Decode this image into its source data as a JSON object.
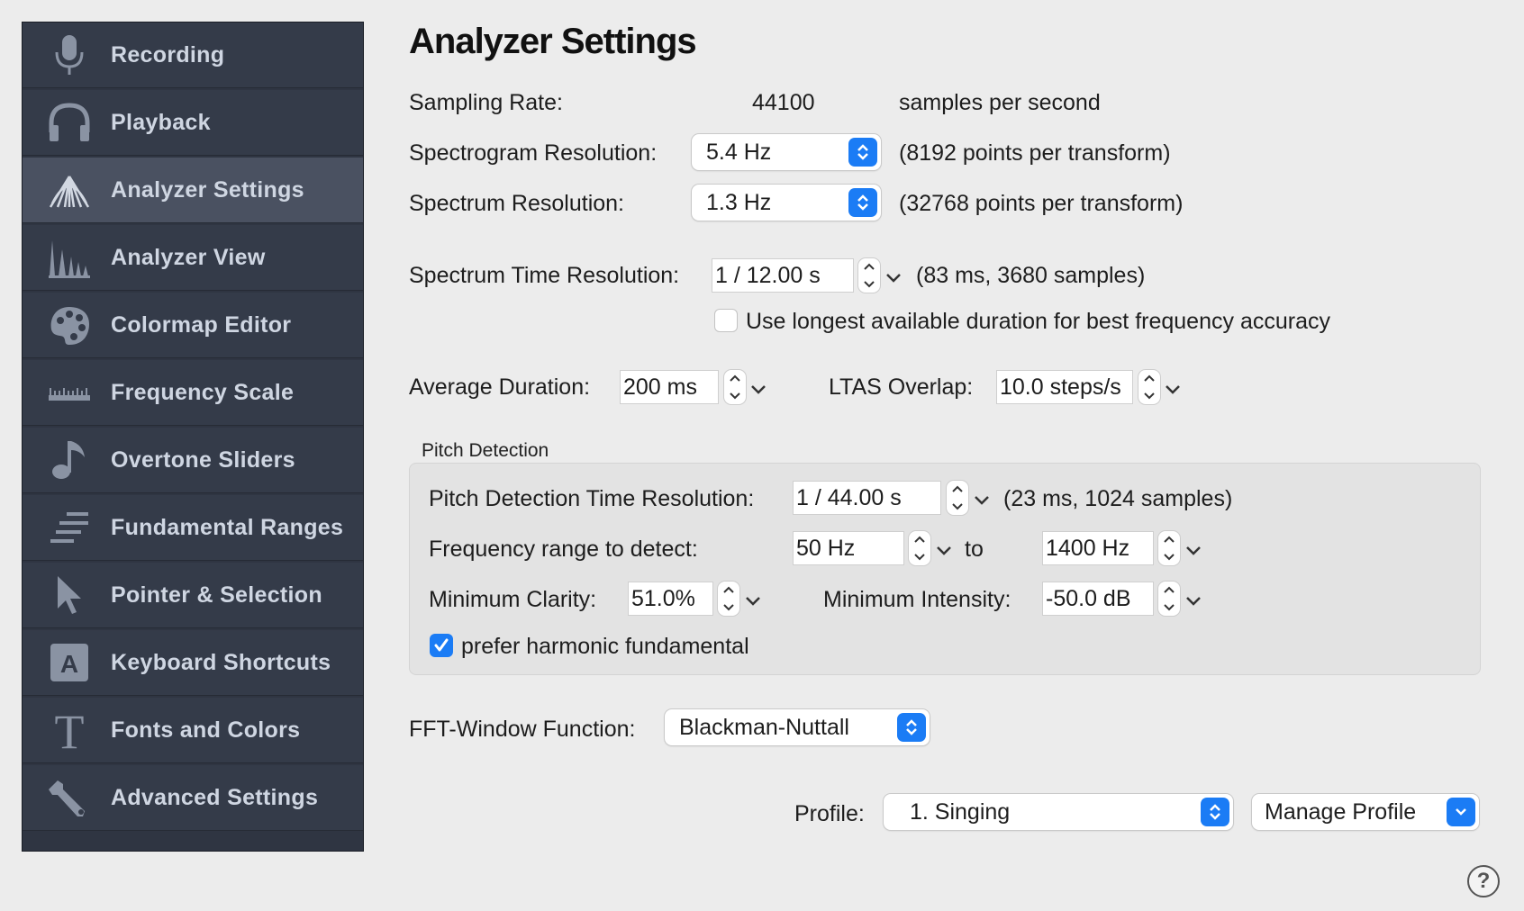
{
  "sidebar": {
    "items": [
      {
        "label": "Recording",
        "icon": "microphone-icon"
      },
      {
        "label": "Playback",
        "icon": "headphones-icon"
      },
      {
        "label": "Analyzer Settings",
        "icon": "analyzer-fan-icon"
      },
      {
        "label": "Analyzer View",
        "icon": "spectrum-peaks-icon"
      },
      {
        "label": "Colormap Editor",
        "icon": "palette-icon"
      },
      {
        "label": "Frequency Scale",
        "icon": "ruler-icon"
      },
      {
        "label": "Overtone Sliders",
        "icon": "music-note-icon"
      },
      {
        "label": "Fundamental Ranges",
        "icon": "ranges-lines-icon"
      },
      {
        "label": "Pointer & Selection",
        "icon": "pointer-arrow-icon"
      },
      {
        "label": "Keyboard Shortcuts",
        "icon": "keyboard-key-icon"
      },
      {
        "label": "Fonts and Colors",
        "icon": "font-t-icon"
      },
      {
        "label": "Advanced Settings",
        "icon": "wrench-icon"
      }
    ],
    "active": "Analyzer Settings"
  },
  "main": {
    "title": "Analyzer Settings",
    "sampling_rate": {
      "label": "Sampling Rate:",
      "value": "44100",
      "unit": "samples per second"
    },
    "spectrogram_resolution": {
      "label": "Spectrogram Resolution:",
      "value": "5.4 Hz",
      "info": "(8192 points per transform)"
    },
    "spectrum_resolution": {
      "label": "Spectrum Resolution:",
      "value": "1.3 Hz",
      "info": "(32768 points per transform)"
    },
    "spectrum_time_resolution": {
      "label": "Spectrum Time Resolution:",
      "value": "1 / 12.00 s",
      "info": "(83 ms, 3680 samples)"
    },
    "longest_duration": {
      "label": "Use longest available duration for best frequency accuracy",
      "checked": false
    },
    "average_duration": {
      "label": "Average Duration:",
      "value": "200 ms"
    },
    "ltas_overlap": {
      "label": "LTAS Overlap:",
      "value": "10.0 steps/s"
    },
    "pitch": {
      "section_label": "Pitch Detection",
      "time_resolution": {
        "label": "Pitch Detection Time Resolution:",
        "value": "1 / 44.00 s",
        "info": "(23 ms, 1024 samples)"
      },
      "freq_range": {
        "label": "Frequency range to detect:",
        "from": "50 Hz",
        "to_label": "to",
        "to": "1400 Hz"
      },
      "min_clarity": {
        "label": "Minimum Clarity:",
        "value": "51.0%"
      },
      "min_intensity": {
        "label": "Minimum Intensity:",
        "value": "-50.0 dB"
      },
      "prefer_harmonic": {
        "label": "prefer harmonic fundamental",
        "checked": true
      }
    },
    "fft_window": {
      "label": "FFT-Window Function:",
      "value": "Blackman-Nuttall"
    },
    "profile": {
      "label": "Profile:",
      "value": "1. Singing",
      "manage": "Manage Profile"
    },
    "help": "?"
  },
  "colors": {
    "sidebar_bg": "#343b49",
    "sidebar_active": "#4a5161",
    "sidebar_text": "#cfd6e2",
    "accent": "#1b7cf5",
    "window_bg": "#ececec"
  }
}
